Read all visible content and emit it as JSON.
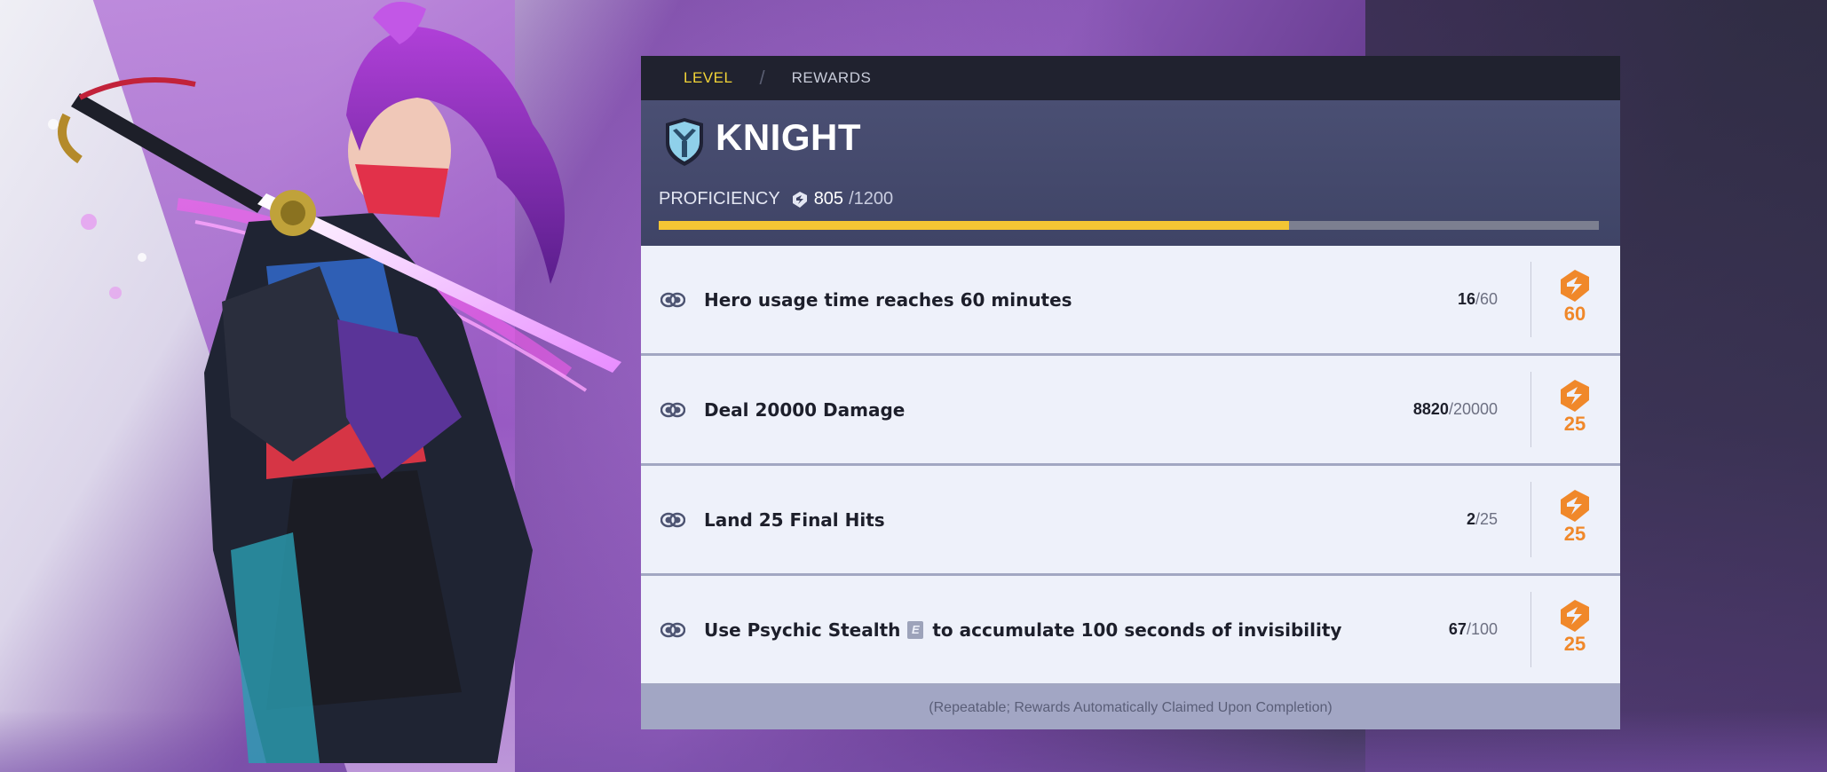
{
  "tabs": [
    {
      "label": "LEVEL",
      "active": true
    },
    {
      "label": "REWARDS",
      "active": false
    }
  ],
  "hero": {
    "class_icon": "shield-icon",
    "class_name": "KNIGHT"
  },
  "proficiency": {
    "label": "PROFICIENCY",
    "icon": "proficiency-icon",
    "current": "805",
    "max": "/1200",
    "fill_fraction": 0.67
  },
  "tasks": [
    {
      "pre": "Hero usage time reaches 60 minutes",
      "key": "",
      "post": "",
      "current": "16",
      "target": "/60",
      "reward": "60"
    },
    {
      "pre": "Deal 20000 Damage",
      "key": "",
      "post": "",
      "current": "8820",
      "target": "/20000",
      "reward": "25"
    },
    {
      "pre": "Land 25 Final Hits",
      "key": "",
      "post": "",
      "current": "2",
      "target": "/25",
      "reward": "25"
    },
    {
      "pre": "Use Psychic Stealth",
      "key": "E",
      "post": "to accumulate 100 seconds of invisibility",
      "current": "67",
      "target": "/100",
      "reward": "25"
    }
  ],
  "footer_note": "(Repeatable; Rewards Automatically Claimed Upon Completion)",
  "colors": {
    "accent_tab": "#f2d437",
    "progress_fill": "#f4c534",
    "reward_orange": "#f0882a"
  }
}
